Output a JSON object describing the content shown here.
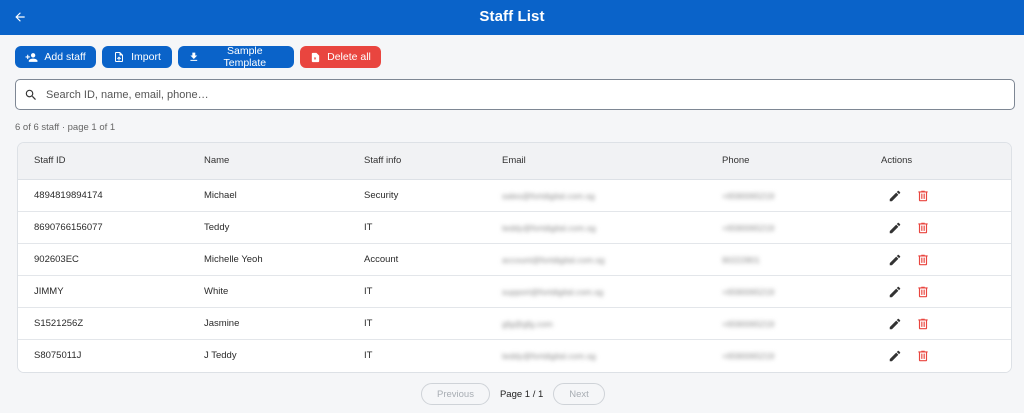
{
  "header": {
    "title": "Staff List",
    "back_icon": "arrow-left-icon",
    "bg_color": "#0a63c9"
  },
  "toolbar": {
    "add_label": "Add staff",
    "import_label": "Import",
    "template_label": "Sample Template",
    "delete_all_label": "Delete all"
  },
  "search": {
    "placeholder": "Search ID, name, email, phone…",
    "value": ""
  },
  "summary": "6 of 6 staff · page 1 of 1",
  "table": {
    "columns": [
      "Staff ID",
      "Name",
      "Staff info",
      "Email",
      "Phone",
      "Actions"
    ],
    "rows": [
      {
        "id": "4894819894174",
        "name": "Michael",
        "info": "Security",
        "email": "sales@fortdigital.com.sg",
        "phone": "+6590065219"
      },
      {
        "id": "8690766156077",
        "name": "Teddy",
        "info": "IT",
        "email": "teddy@fortdigital.com.sg",
        "phone": "+6590065219"
      },
      {
        "id": "902603EC",
        "name": "Michelle Yeoh",
        "info": "Account",
        "email": "account@fortdigital.com.sg",
        "phone": "90222801"
      },
      {
        "id": "JIMMY",
        "name": "White",
        "info": "IT",
        "email": "support@fortdigital.com.sg",
        "phone": "+6590065219"
      },
      {
        "id": "S1521256Z",
        "name": "Jasmine",
        "info": "IT",
        "email": "gfg@gfg.com",
        "phone": "+6590065219"
      },
      {
        "id": "S8075011J",
        "name": "J Teddy",
        "info": "IT",
        "email": "teddy@fortdigital.com.sg",
        "phone": "+6590065219"
      }
    ]
  },
  "pagination": {
    "prev_label": "Previous",
    "page_label": "Page 1 / 1",
    "next_label": "Next"
  },
  "colors": {
    "primary": "#0a63c9",
    "danger": "#e9453f",
    "edit_icon": "#333333"
  }
}
